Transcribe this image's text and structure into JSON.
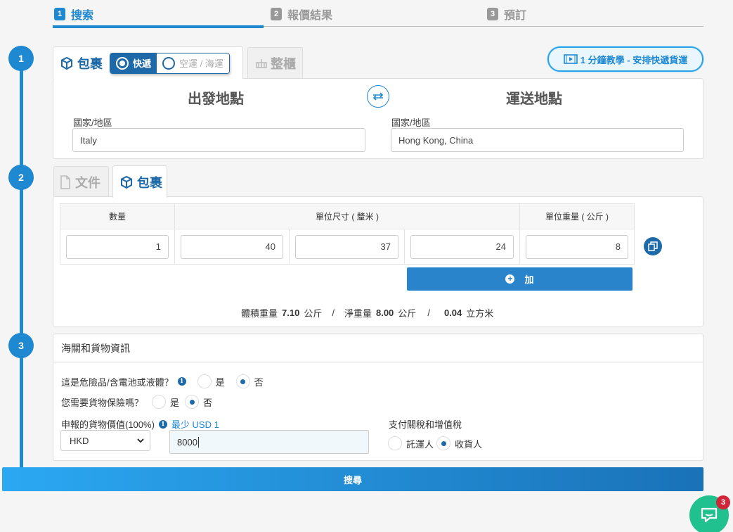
{
  "stepper": {
    "steps": [
      {
        "num": "1",
        "label": "搜索"
      },
      {
        "num": "2",
        "label": "報價結果"
      },
      {
        "num": "3",
        "label": "預訂"
      }
    ]
  },
  "timeline": [
    "1",
    "2",
    "3"
  ],
  "section1": {
    "tab_parcel": "包裹",
    "opt_express": "快遞",
    "opt_freight": "空運 / 海運",
    "tab_container": "整櫃",
    "tutorial": "1 分鐘教學 - 安排快遞貨運",
    "origin_title": "出發地點",
    "dest_title": "運送地點",
    "origin_label": "國家/地區",
    "origin_value": "Italy",
    "dest_label": "國家/地區",
    "dest_value": "Hong Kong, China"
  },
  "section2": {
    "tab_document": "文件",
    "tab_parcel": "包裹",
    "headers": {
      "qty": "數量",
      "dims": "單位尺寸 ( 釐米 )",
      "weight": "單位重量 ( 公斤 )"
    },
    "row": {
      "qty": "1",
      "length": "40",
      "width": "37",
      "height": "24",
      "weight": "8"
    },
    "add_label": "加",
    "summary": {
      "vol_label": "體積重量",
      "vol_value": "7.10",
      "vol_unit": "公斤",
      "sep1": "/",
      "net_label": "淨重量",
      "net_value": "8.00",
      "net_unit": "公斤",
      "sep2": "/",
      "cbm_value": "0.04",
      "cbm_unit": "立方米"
    }
  },
  "section3": {
    "title": "海關和貨物資訊",
    "dangerous_q": "這是危險品/含電池或液體？",
    "insurance_q": "您需要貨物保險嗎？",
    "yes": "是",
    "no": "否",
    "declared_label": "申報的貨物價值(100%)",
    "min_note": "最少 USD 1",
    "currency": "HKD",
    "declared_value": "8000",
    "duty_label": "支付關稅和增值稅",
    "duty_shipper": "託運人",
    "duty_consignee": "收貨人"
  },
  "search_label": "搜尋",
  "chat": {
    "badge": "3"
  },
  "colors": {
    "primary": "#1e88d1",
    "dark_primary": "#1e6aa8",
    "chat": "#21c18f",
    "badge": "#d0263a"
  }
}
